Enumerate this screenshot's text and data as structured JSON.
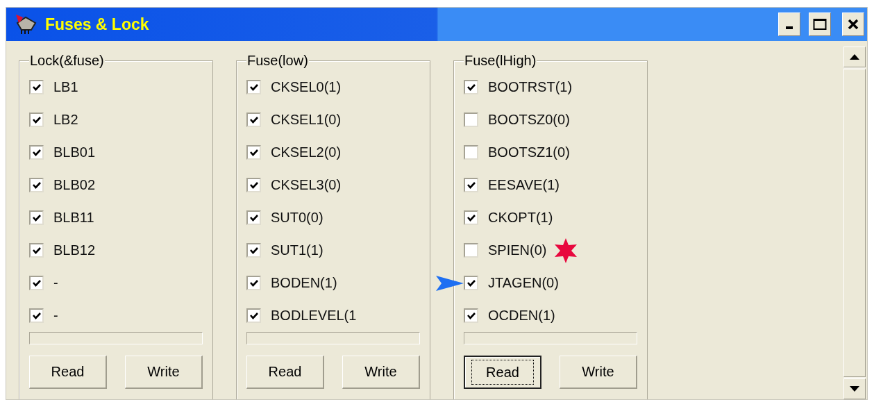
{
  "window": {
    "title": "Fuses & Lock"
  },
  "groups": [
    {
      "title": "Lock(&fuse)",
      "items": [
        {
          "label": "LB1",
          "checked": true
        },
        {
          "label": "LB2",
          "checked": true
        },
        {
          "label": "BLB01",
          "checked": true
        },
        {
          "label": "BLB02",
          "checked": true
        },
        {
          "label": "BLB11",
          "checked": true
        },
        {
          "label": "BLB12",
          "checked": true
        },
        {
          "label": "-",
          "checked": true
        },
        {
          "label": "-",
          "checked": true
        }
      ],
      "progress": {
        "level": 0
      },
      "buttons": [
        {
          "label": "Read",
          "focused": false
        },
        {
          "label": "Write",
          "focused": false
        }
      ]
    },
    {
      "title": "Fuse(low)",
      "items": [
        {
          "label": "CKSEL0(1)",
          "checked": true
        },
        {
          "label": "CKSEL1(0)",
          "checked": true
        },
        {
          "label": "CKSEL2(0)",
          "checked": true
        },
        {
          "label": "CKSEL3(0)",
          "checked": true
        },
        {
          "label": "SUT0(0)",
          "checked": true
        },
        {
          "label": "SUT1(1)",
          "checked": true
        },
        {
          "label": "BODEN(1)",
          "checked": true
        },
        {
          "label": "BODLEVEL(1",
          "checked": true
        }
      ],
      "progress": {
        "level": 0
      },
      "buttons": [
        {
          "label": "Read",
          "focused": false
        },
        {
          "label": "Write",
          "focused": false
        }
      ]
    },
    {
      "title": "Fuse(lHigh)",
      "items": [
        {
          "label": "BOOTRST(1)",
          "checked": true,
          "starred": false,
          "arrowed": false
        },
        {
          "label": "BOOTSZ0(0)",
          "checked": false,
          "starred": false,
          "arrowed": false
        },
        {
          "label": "BOOTSZ1(0)",
          "checked": false,
          "starred": false,
          "arrowed": false
        },
        {
          "label": "EESAVE(1)",
          "checked": true,
          "starred": false,
          "arrowed": false
        },
        {
          "label": "CKOPT(1)",
          "checked": true,
          "starred": false,
          "arrowed": false
        },
        {
          "label": "SPIEN(0)",
          "checked": false,
          "starred": true,
          "arrowed": false
        },
        {
          "label": "JTAGEN(0)",
          "checked": true,
          "starred": false,
          "arrowed": true
        },
        {
          "label": "OCDEN(1)",
          "checked": true,
          "starred": false,
          "arrowed": false
        }
      ],
      "progress": {
        "level": 0
      },
      "buttons": [
        {
          "label": "Read",
          "focused": true
        },
        {
          "label": "Write",
          "focused": false
        }
      ]
    }
  ]
}
